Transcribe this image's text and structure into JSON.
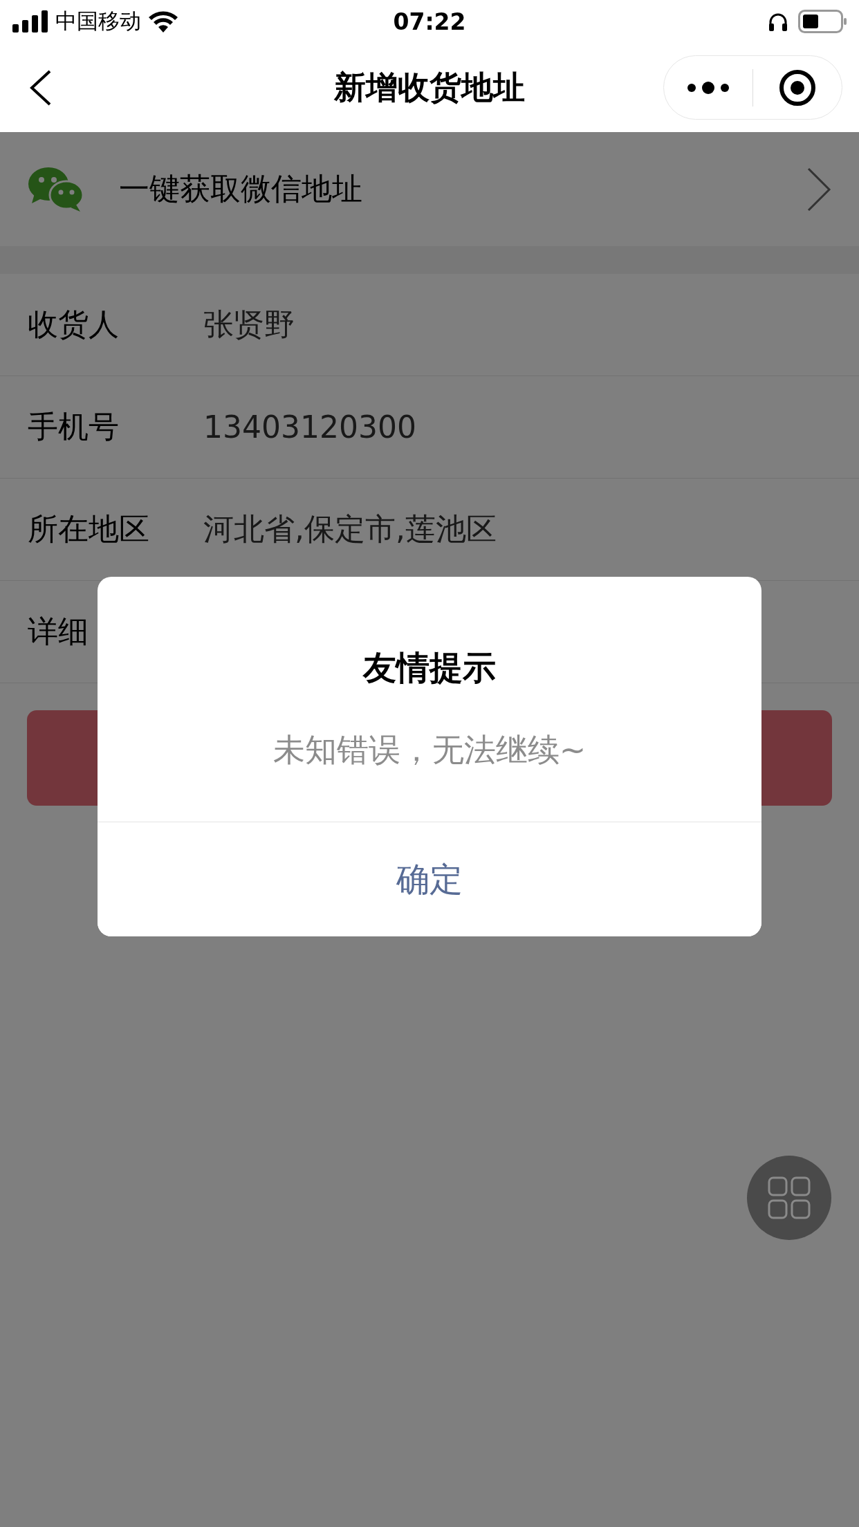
{
  "status_bar": {
    "carrier": "中国移动",
    "time": "07:22"
  },
  "nav": {
    "title": "新增收货地址"
  },
  "wechat_import": {
    "label": "一键获取微信地址"
  },
  "form": {
    "rows": [
      {
        "label": "收货人",
        "value": "张贤野"
      },
      {
        "label": "手机号",
        "value": "13403120300"
      },
      {
        "label": "所在地区",
        "value": "河北省,保定市,莲池区"
      },
      {
        "label": "详细"
      }
    ]
  },
  "dialog": {
    "title": "友情提示",
    "message": "未知错误，无法继续~",
    "button": "确定"
  }
}
